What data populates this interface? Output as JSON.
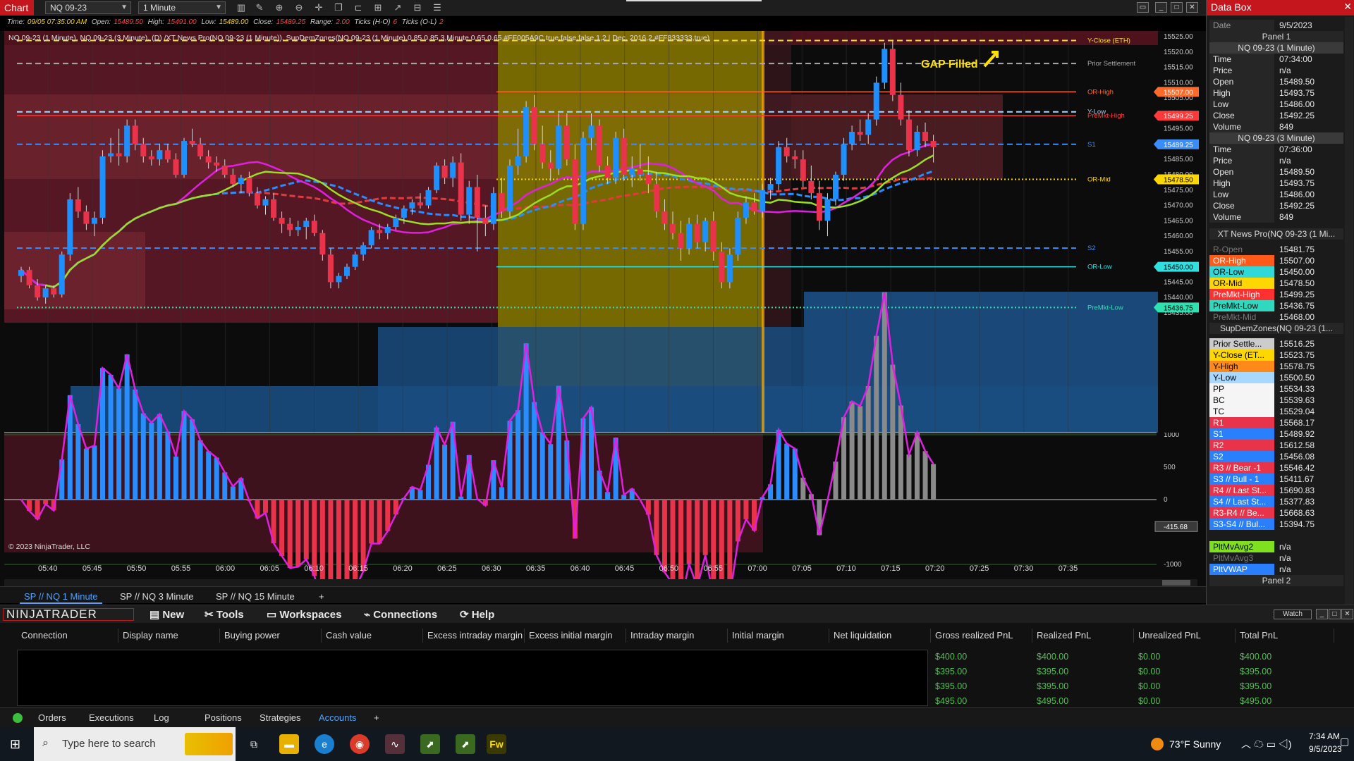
{
  "window": {
    "tab_label": "Chart",
    "instrument": "NQ 09-23",
    "interval": "1 Minute"
  },
  "infobar": {
    "time_label": "Time:",
    "time": "09/05 07:35:00 AM",
    "open_label": "Open:",
    "open": "15489.50",
    "high_label": "High:",
    "high": "15491.00",
    "low_label": "Low:",
    "low": "15489.00",
    "close_label": "Close:",
    "close": "15489.25",
    "range_label": "Range:",
    "range": "2.00",
    "ticks_hl_label": "Ticks (H-O)",
    "ticks_hl": "6",
    "ticks_ol_label": "Ticks (O-L)",
    "ticks_ol": "2"
  },
  "indicator_line": "NQ 09-23 (1 Minute), NQ 09-23 (3 Minute), (D) /XT News Pro(NQ 09-23 (1 Minute)), SupDemZones(NQ 09-23 (1 Minute),0.85,0.85,3,Minute,0.65,0.65,#FF005A9C,true,false,false,1,2 | Dec. 2016,2,#FF833333,true)",
  "annotation": "GAP Filled",
  "copyright": "© 2023 NinjaTrader, LLC",
  "colors": {
    "up": "#1e8fff",
    "down": "#e8334a",
    "brand_red": "#c4161c",
    "accent_blue": "#4aa3ff",
    "pnl_green": "#4ec24e",
    "zone_red": "#6e1c2a",
    "zone_blue": "#1a4c80",
    "zone_yellow": "#8a7a00"
  },
  "chart_data": {
    "type": "candlestick",
    "price_axis": {
      "min": 15435,
      "max": 15525,
      "ticks": [
        "15525.00",
        "15520.00",
        "15515.00",
        "15510.00",
        "15505.00",
        "15500.00",
        "15495.00",
        "15490.00",
        "15485.00",
        "15480.00",
        "15475.00",
        "15470.00",
        "15465.00",
        "15460.00",
        "15455.00",
        "15450.00",
        "15445.00",
        "15440.00",
        "15435.00"
      ]
    },
    "time_ticks": [
      "05:40",
      "05:45",
      "05:50",
      "05:55",
      "06:00",
      "06:05",
      "06:10",
      "06:15",
      "06:20",
      "06:25",
      "06:30",
      "06:35",
      "06:40",
      "06:45",
      "06:50",
      "06:55",
      "07:00",
      "07:05",
      "07:10",
      "07:15",
      "07:20",
      "07:25",
      "07:30",
      "07:35"
    ],
    "levels": [
      {
        "name": "Y-Close (ETH)",
        "price": 15523.75,
        "color": "#f0e020",
        "style": "dash"
      },
      {
        "name": "Prior Settlement",
        "price": 15516.25,
        "color": "#aaaaaa",
        "style": "dash"
      },
      {
        "name": "OR-High",
        "price": 15507.0,
        "color": "#ff6a2a",
        "style": "solid",
        "tag": "15507.00"
      },
      {
        "name": "Y-Low",
        "price": 15500.5,
        "color": "#a8d8ff",
        "style": "dash"
      },
      {
        "name": "PreMkt-High",
        "price": 15499.25,
        "color": "#ff3a3a",
        "style": "solid",
        "tag": "15499.25"
      },
      {
        "name": "S1",
        "price": 15489.92,
        "color": "#3a8dff",
        "style": "dash",
        "tag": "15489.25"
      },
      {
        "name": "OR-Mid",
        "price": 15478.5,
        "color": "#ffd700",
        "style": "dot",
        "tag": "15478.50"
      },
      {
        "name": "S2",
        "price": 15456.08,
        "color": "#3a8dff",
        "style": "dash"
      },
      {
        "name": "OR-Low",
        "price": 15450.0,
        "color": "#30e0e0",
        "style": "solid",
        "tag": "15450.00"
      },
      {
        "name": "PreMkt-Low",
        "price": 15436.75,
        "color": "#30e0b0",
        "style": "dot",
        "tag": "15436.75"
      }
    ],
    "candles": [
      [
        15447,
        15450,
        15445,
        15449
      ],
      [
        15449,
        15450,
        15443,
        15444
      ],
      [
        15444,
        15446,
        15439,
        15440
      ],
      [
        15440,
        15444,
        15438,
        15443
      ],
      [
        15443,
        15444,
        15440,
        15441
      ],
      [
        15441,
        15455,
        15440,
        15454
      ],
      [
        15454,
        15474,
        15452,
        15472
      ],
      [
        15472,
        15476,
        15466,
        15468
      ],
      [
        15468,
        15470,
        15462,
        15464
      ],
      [
        15464,
        15468,
        15460,
        15466
      ],
      [
        15466,
        15488,
        15464,
        15486
      ],
      [
        15486,
        15492,
        15484,
        15487
      ],
      [
        15487,
        15495,
        15483,
        15486
      ],
      [
        15486,
        15498,
        15484,
        15496
      ],
      [
        15496,
        15498,
        15488,
        15490
      ],
      [
        15490,
        15492,
        15484,
        15486
      ],
      [
        15486,
        15488,
        15483,
        15485
      ],
      [
        15485,
        15490,
        15483,
        15488
      ],
      [
        15488,
        15490,
        15484,
        15485
      ],
      [
        15485,
        15487,
        15479,
        15480
      ],
      [
        15480,
        15492,
        15479,
        15491
      ],
      [
        15491,
        15495,
        15489,
        15490
      ],
      [
        15490,
        15492,
        15485,
        15486
      ],
      [
        15486,
        15488,
        15482,
        15484
      ],
      [
        15484,
        15486,
        15481,
        15483
      ],
      [
        15483,
        15485,
        15479,
        15480
      ],
      [
        15480,
        15482,
        15476,
        15477
      ],
      [
        15477,
        15480,
        15474,
        15479
      ],
      [
        15479,
        15481,
        15473,
        15474
      ],
      [
        15474,
        15476,
        15469,
        15470
      ],
      [
        15470,
        15473,
        15467,
        15472
      ],
      [
        15472,
        15474,
        15465,
        15466
      ],
      [
        15466,
        15468,
        15461,
        15464
      ],
      [
        15464,
        15466,
        15460,
        15462
      ],
      [
        15462,
        15465,
        15460,
        15463
      ],
      [
        15463,
        15466,
        15459,
        15465
      ],
      [
        15465,
        15467,
        15460,
        15461
      ],
      [
        15461,
        15462,
        15452,
        15454
      ],
      [
        15454,
        15456,
        15443,
        15445
      ],
      [
        15445,
        15448,
        15443,
        15447
      ],
      [
        15447,
        15451,
        15446,
        15450
      ],
      [
        15450,
        15455,
        15449,
        15454
      ],
      [
        15454,
        15458,
        15452,
        15457
      ],
      [
        15457,
        15463,
        15456,
        15462
      ],
      [
        15462,
        15464,
        15459,
        15461
      ],
      [
        15461,
        15464,
        15459,
        15463
      ],
      [
        15463,
        15467,
        15462,
        15466
      ],
      [
        15466,
        15470,
        15464,
        15469
      ],
      [
        15469,
        15472,
        15467,
        15471
      ],
      [
        15471,
        15474,
        15469,
        15470
      ],
      [
        15470,
        15476,
        15469,
        15475
      ],
      [
        15475,
        15484,
        15474,
        15483
      ],
      [
        15483,
        15485,
        15477,
        15479
      ],
      [
        15479,
        15486,
        15476,
        15484
      ],
      [
        15484,
        15487,
        15465,
        15467
      ],
      [
        15467,
        15478,
        15464,
        15476
      ],
      [
        15476,
        15480,
        15455,
        15466
      ],
      [
        15466,
        15470,
        15460,
        15464
      ],
      [
        15464,
        15476,
        15462,
        15474
      ],
      [
        15474,
        15479,
        15466,
        15468
      ],
      [
        15468,
        15485,
        15466,
        15483
      ],
      [
        15483,
        15495,
        15480,
        15486
      ],
      [
        15486,
        15504,
        15484,
        15502
      ],
      [
        15502,
        15506,
        15488,
        15490
      ],
      [
        15490,
        15496,
        15482,
        15484
      ],
      [
        15484,
        15488,
        15478,
        15482
      ],
      [
        15482,
        15500,
        15480,
        15496
      ],
      [
        15496,
        15500,
        15483,
        15485
      ],
      [
        15485,
        15490,
        15462,
        15464
      ],
      [
        15464,
        15494,
        15462,
        15492
      ],
      [
        15492,
        15500,
        15488,
        15496
      ],
      [
        15496,
        15498,
        15481,
        15483
      ],
      [
        15483,
        15486,
        15477,
        15479
      ],
      [
        15479,
        15494,
        15477,
        15492
      ],
      [
        15492,
        15495,
        15478,
        15480
      ],
      [
        15480,
        15486,
        15476,
        15482
      ],
      [
        15482,
        15490,
        15478,
        15480
      ],
      [
        15480,
        15486,
        15474,
        15477
      ],
      [
        15477,
        15481,
        15466,
        15468
      ],
      [
        15468,
        15472,
        15462,
        15464
      ],
      [
        15464,
        15468,
        15459,
        15461
      ],
      [
        15461,
        15465,
        15452,
        15456
      ],
      [
        15456,
        15466,
        15454,
        15464
      ],
      [
        15464,
        15467,
        15456,
        15458
      ],
      [
        15458,
        15466,
        15455,
        15465
      ],
      [
        15465,
        15468,
        15452,
        15455
      ],
      [
        15455,
        15458,
        15443,
        15445
      ],
      [
        15445,
        15456,
        15443,
        15454
      ],
      [
        15454,
        15468,
        15452,
        15466
      ],
      [
        15466,
        15473,
        15464,
        15471
      ],
      [
        15471,
        15474,
        15467,
        15468
      ],
      [
        15468,
        15477,
        15466,
        15475
      ],
      [
        15475,
        15479,
        15472,
        15477
      ],
      [
        15477,
        15491,
        15475,
        15489
      ],
      [
        15489,
        15492,
        15484,
        15486
      ],
      [
        15486,
        15488,
        15482,
        15485
      ],
      [
        15485,
        15488,
        15476,
        15478
      ],
      [
        15478,
        15483,
        15472,
        15474
      ],
      [
        15474,
        15478,
        15462,
        15465
      ],
      [
        15465,
        15474,
        15460,
        15472
      ],
      [
        15472,
        15481,
        15470,
        15480
      ],
      [
        15480,
        15492,
        15478,
        15490
      ],
      [
        15490,
        15496,
        15488,
        15494
      ],
      [
        15494,
        15498,
        15491,
        15493
      ],
      [
        15493,
        15500,
        15490,
        15498
      ],
      [
        15498,
        15512,
        15496,
        15510
      ],
      [
        15510,
        15523,
        15508,
        15521
      ],
      [
        15521,
        15524,
        15504,
        15506
      ],
      [
        15506,
        15510,
        15496,
        15498
      ],
      [
        15498,
        15501,
        15486,
        15488
      ],
      [
        15488,
        15496,
        15486,
        15494
      ],
      [
        15494,
        15497,
        15489,
        15491
      ],
      [
        15491,
        15493,
        15484,
        15489
      ]
    ],
    "oscillator": {
      "ticks": [
        "1000",
        "500",
        "0",
        "-1000"
      ],
      "value_tag": "-415.68"
    }
  },
  "chart_tabs": [
    "SP // NQ  1 Minute",
    "SP // NQ  3 Minute",
    "SP // NQ  15 Minute",
    "+"
  ],
  "databox": {
    "title": "Data Box",
    "date_label": "Date",
    "date": "9/5/2023",
    "panel1": "Panel 1",
    "series1_title": "NQ 09-23 (1 Minute)",
    "series1": [
      [
        "Time",
        "07:34:00"
      ],
      [
        "Price",
        "n/a"
      ],
      [
        "Open",
        "15489.50"
      ],
      [
        "High",
        "15493.75"
      ],
      [
        "Low",
        "15486.00"
      ],
      [
        "Close",
        "15492.25"
      ],
      [
        "Volume",
        "849"
      ]
    ],
    "series2_title": "NQ 09-23 (3 Minute)",
    "series2": [
      [
        "Time",
        "07:36:00"
      ],
      [
        "Price",
        "n/a"
      ],
      [
        "Open",
        "15489.50"
      ],
      [
        "High",
        "15493.75"
      ],
      [
        "Low",
        "15486.00"
      ],
      [
        "Close",
        "15492.25"
      ],
      [
        "Volume",
        "849"
      ]
    ],
    "xt_title": "XT News Pro(NQ 09-23 (1 Mi...",
    "xt": [
      [
        "R-Open",
        "15481.75",
        "#1b1b1b",
        "#777"
      ],
      [
        "OR-High",
        "15507.00",
        "#ff5a1a",
        "#fff"
      ],
      [
        "OR-Low",
        "15450.00",
        "#30d8d8",
        "#000"
      ],
      [
        "OR-Mid",
        "15478.50",
        "#ffd700",
        "#000"
      ],
      [
        "PreMkt-High",
        "15499.25",
        "#ff3030",
        "#fff"
      ],
      [
        "PreMkt-Low",
        "15436.75",
        "#30d8c0",
        "#000"
      ],
      [
        "PreMkt-Mid",
        "15468.00",
        "#1b1b1b",
        "#777"
      ]
    ],
    "sdz_title": "SupDemZones(NQ 09-23 (1...",
    "sdz": [
      [
        "Prior Settle...",
        "15516.25",
        "#cccccc",
        "#000"
      ],
      [
        "Y-Close (ET...",
        "15523.75",
        "#ffd700",
        "#000"
      ],
      [
        "Y-High",
        "15578.75",
        "#ff8a1a",
        "#000"
      ],
      [
        "Y-Low",
        "15500.50",
        "#a8d8ff",
        "#000"
      ],
      [
        "PP",
        "15534.33",
        "#f5f5f5",
        "#000"
      ],
      [
        "BC",
        "15539.63",
        "#f5f5f5",
        "#000"
      ],
      [
        "TC",
        "15529.04",
        "#f5f5f5",
        "#000"
      ],
      [
        "R1",
        "15568.17",
        "#e8334a",
        "#fff"
      ],
      [
        "S1",
        "15489.92",
        "#2a7fff",
        "#fff"
      ],
      [
        "R2",
        "15612.58",
        "#e8334a",
        "#fff"
      ],
      [
        "S2",
        "15456.08",
        "#2a7fff",
        "#fff"
      ],
      [
        "R3 // Bear -1",
        "15546.42",
        "#e8334a",
        "#fff"
      ],
      [
        "S3 // Bull - 1",
        "15411.67",
        "#2a7fff",
        "#fff"
      ],
      [
        "R4 // Last St...",
        "15690.83",
        "#e8334a",
        "#fff"
      ],
      [
        "S4 // Last St...",
        "15377.83",
        "#2a7fff",
        "#fff"
      ],
      [
        "R3-R4 // Be...",
        "15668.63",
        "#e8334a",
        "#fff"
      ],
      [
        "S3-S4 // Bul...",
        "15394.75",
        "#2a7fff",
        "#fff"
      ]
    ],
    "pltf": [
      [
        "PltMvAvg2",
        "n/a",
        "#7fe020",
        "#000"
      ],
      [
        "PltMvAvg3",
        "n/a",
        "#1b1b1b",
        "#777"
      ],
      [
        "PltVWAP",
        "n/a",
        "#2a7fff",
        "#fff"
      ]
    ],
    "panel2": "Panel 2"
  },
  "ntbar": {
    "logo": "NINJATRADER",
    "menu": [
      "New",
      "Tools",
      "Workspaces",
      "Connections",
      "Help"
    ],
    "watch": "Watch"
  },
  "accounts": {
    "columns": [
      "Connection",
      "Display name",
      "Buying power",
      "Cash value",
      "Excess intraday margin",
      "Excess initial margin",
      "Intraday margin",
      "Initial margin",
      "Net liquidation",
      "Gross realized PnL",
      "Realized PnL",
      "Unrealized PnL",
      "Total PnL"
    ],
    "rows": [
      [
        "$400.00",
        "$400.00",
        "$0.00",
        "$400.00"
      ],
      [
        "$395.00",
        "$395.00",
        "$0.00",
        "$395.00"
      ],
      [
        "$395.00",
        "$395.00",
        "$0.00",
        "$395.00"
      ],
      [
        "$495.00",
        "$495.00",
        "$0.00",
        "$495.00"
      ]
    ]
  },
  "bottom_tabs": [
    "Orders",
    "Executions",
    "Log",
    "Positions",
    "Strategies",
    "Accounts",
    "+"
  ],
  "taskbar": {
    "search_placeholder": "Type here to search",
    "weather": "73°F  Sunny",
    "time": "7:34 AM",
    "date": "9/5/2023"
  }
}
